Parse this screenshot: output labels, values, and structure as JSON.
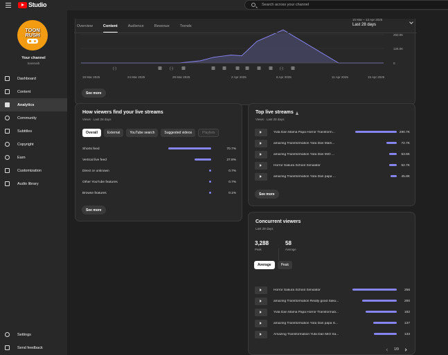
{
  "app": {
    "logo_text": "Studio"
  },
  "search": {
    "placeholder": "Search across your channel"
  },
  "channel": {
    "avatar_line1": "TOON",
    "avatar_line2": "RUSH",
    "label": "Your channel",
    "handle": "toonrush"
  },
  "nav": {
    "items": [
      {
        "label": "Dashboard",
        "icon": "dashboard-icon"
      },
      {
        "label": "Content",
        "icon": "content-icon"
      },
      {
        "label": "Analytics",
        "icon": "analytics-icon",
        "active": true
      },
      {
        "label": "Community",
        "icon": "community-icon"
      },
      {
        "label": "Subtitles",
        "icon": "subtitles-icon"
      },
      {
        "label": "Copyright",
        "icon": "copyright-icon"
      },
      {
        "label": "Earn",
        "icon": "earn-icon"
      },
      {
        "label": "Customization",
        "icon": "customization-icon"
      },
      {
        "label": "Audio library",
        "icon": "audio-library-icon"
      }
    ],
    "bottom": [
      {
        "label": "Settings",
        "icon": "gear-icon"
      },
      {
        "label": "Send feedback",
        "icon": "feedback-icon"
      }
    ]
  },
  "tabs": [
    "Overview",
    "Content",
    "Audience",
    "Revenue",
    "Trends"
  ],
  "active_tab": "Content",
  "date_range": {
    "range": "15 Mar – 13 Apr 2025",
    "label": "Last 28 days"
  },
  "colors": {
    "accent": "#8684f0",
    "brand": "#ff0000",
    "avatar": "#f39c12"
  },
  "chart_data": {
    "type": "area",
    "x_labels": [
      "19 Mar 2025",
      "24 Mar 2025",
      "28 Mar 2025",
      "2 Apr 2025",
      "6 Apr 2025",
      "11 Apr 2025",
      "15 Apr 2025"
    ],
    "y_ticks": [
      "250.0K",
      "125.0K",
      "0"
    ],
    "ylim": [
      0,
      250000
    ],
    "x": [
      "19 Mar",
      "22 Mar",
      "25 Mar",
      "28 Mar",
      "31 Mar",
      "2 Apr",
      "4 Apr",
      "5 Apr",
      "6 Apr",
      "7 Apr",
      "11 Apr",
      "15 Apr"
    ],
    "values": [
      0,
      0,
      0,
      0,
      15000,
      40000,
      55000,
      50000,
      150000,
      230000,
      0,
      0
    ]
  },
  "top_card": {
    "see_more": "See more"
  },
  "find_streams": {
    "title": "How viewers find your live streams",
    "subtitle": "Views · Last 28 days",
    "pills": [
      "Overall",
      "External",
      "YouTube search",
      "Suggested videos",
      "Playlists"
    ],
    "rows": [
      {
        "label": "Shorts feed",
        "value": "70.7%",
        "pct": 70.7
      },
      {
        "label": "Vertical live feed",
        "value": "27.8%",
        "pct": 27.8
      },
      {
        "label": "Direct or unknown",
        "value": "0.7%",
        "pct": 0.7
      },
      {
        "label": "Other YouTube features",
        "value": "0.7%",
        "pct": 0.7
      },
      {
        "label": "Browse features",
        "value": "0.1%",
        "pct": 0.1
      }
    ],
    "see_more": "See more"
  },
  "top_streams": {
    "title": "Top live streams",
    "subtitle": "Views · Last 28 days",
    "rows": [
      {
        "title": "Yuta Dan Mama Papa Horror Transform...",
        "value": "290.7K",
        "num": 290.7
      },
      {
        "title": "amazing Transformation Yuta Dan Mam...",
        "value": "72.7K",
        "num": 72.7
      },
      {
        "title": "amazing Transformation Yuta Dan MiO ...",
        "value": "53.6K",
        "num": 53.6
      },
      {
        "title": "Horror Sakura School Simulator",
        "value": "52.7K",
        "num": 52.7
      },
      {
        "title": "amazing Transformation Yuta Dan papa ...",
        "value": "45.8K",
        "num": 45.8
      }
    ],
    "see_more": "See more"
  },
  "concurrent": {
    "title": "Concurrent viewers",
    "subtitle": "Last 28 days",
    "peak_value": "3,288",
    "peak_label": "Peak",
    "avg_value": "58",
    "avg_label": "Average",
    "pills": [
      "Average",
      "Peak"
    ],
    "rows": [
      {
        "title": "Horror Sakura School Simulator",
        "value": "256",
        "num": 256
      },
      {
        "title": "amazing Transformation Really good Saku...",
        "value": "200",
        "num": 200
      },
      {
        "title": "Yuta Dan Mama Papa Horror Transformati...",
        "value": "182",
        "num": 182
      },
      {
        "title": "amazing Transformation Yuta Dan papa S...",
        "value": "137",
        "num": 137
      },
      {
        "title": "Amazing Transformation Yuta Dan MiO Sa...",
        "value": "133",
        "num": 133
      }
    ],
    "pager": "1/9"
  }
}
